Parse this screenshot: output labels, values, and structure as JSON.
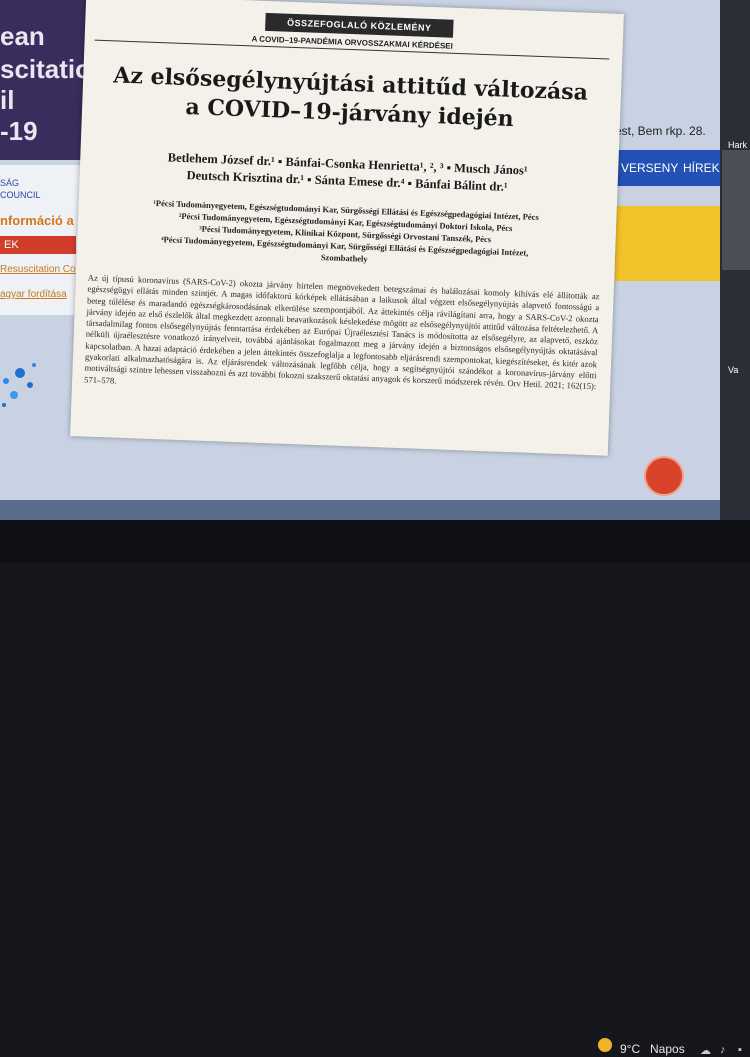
{
  "background_site": {
    "banner_lines": [
      "ean",
      "scitation",
      "il",
      "-19"
    ],
    "council_lines": [
      "SÁG",
      "COUNCIL"
    ],
    "info_heading": "nformáció a",
    "red_button": "EK",
    "links": [
      "Resuscitation Co",
      "agyar fordítása"
    ],
    "address": "est, Bem rkp. 28.",
    "nav_items": [
      "VERSENY",
      "HÍREK"
    ]
  },
  "video_panel": {
    "names": [
      "Hark",
      "Va"
    ]
  },
  "document": {
    "section_label": "ÖSSZEFOGLALÓ KÖZLEMÉNY",
    "subsection_label": "A COVID–19-PANDÉMIA ORVOSSZAKMAI KÉRDÉSEI",
    "title_line1": "Az elsősegélynyújtási attitűd változása",
    "title_line2": "a COVID–19-járvány idején",
    "authors_line1": "Betlehem József dr.¹ ▪ Bánfai-Csonka Henrietta¹, ², ³ ▪ Musch János¹",
    "authors_line2": "Deutsch Krisztina dr.¹ ▪ Sánta Emese dr.⁴ ▪ Bánfai Bálint dr.¹",
    "affiliations": [
      "¹Pécsi Tudományegyetem, Egészségtudományi Kar, Sürgősségi Ellátási és Egészségpedagógiai Intézet, Pécs",
      "²Pécsi Tudományegyetem, Egészségtudományi Kar, Egészségtudományi Doktori Iskola, Pécs",
      "³Pécsi Tudományegyetem, Klinikai Központ, Sürgősségi Orvostani Tanszék, Pécs",
      "⁴Pécsi Tudományegyetem, Egészségtudományi Kar, Sürgősségi Ellátási és Egészségpedagógiai Intézet,",
      "Szombathely"
    ],
    "abstract": "Az új típusú koronavírus (SARS-CoV-2) okozta járvány hirtelen megnövekedett betegszámai és halálozásai komoly kihívás elé állították az egészségügyi ellátás minden szintjét. A magas időfaktorú kórképek ellátásában a laikusok által végzett elsősegélynyújtás alapvető fontosságú a beteg túlélése és maradandó egészségkárosodásának elkerülése szempontjából. Az áttekintés célja rávilágítani arra, hogy a SARS-CoV-2 okozta járvány idején az első észlelők által megkezdett azonnali beavatkozások késlekedése mögött az elsősegélynyújtói attitűd változása feltételezhető. A társadalmilag fontos elsősegélynyújtás fenntartása érdekében az Európai Újraélesztési Tanács is módosította az elsősegélyre, az alapvető, eszköz nélküli újraélesztésre vonatkozó irányelveit, továbbá ajánlásokat fogalmazott meg a járvány idején a biztonságos elsősegélynyújtás oktatásával kapcsolatban. A hazai adaptáció érdekében a jelen áttekintés összefoglalja a legfontosabb eljárásrendi szempontokat, kiegészítéseket, és kitér azok gyakorlati alkalmazhatóságára is. Az eljárásrendek változásának legfőbb célja, hogy a segítségnyújtói szándékot a koronavírus-járvány előtti motiváltsági szintre lehessen visszahozni és azt további fokozni szakszerű oktatási anyagok és korszerű módszerek révén.",
    "citation": "Orv Hetil. 2021; 162(15): 571–578."
  },
  "taskbar": {
    "temperature": "9°C",
    "weather_label": "Napos"
  },
  "colors": {
    "banner": "#3a2c5c",
    "accent_blue": "#2352b4",
    "accent_yellow": "#f2c22a",
    "record_button": "#d8432a"
  }
}
